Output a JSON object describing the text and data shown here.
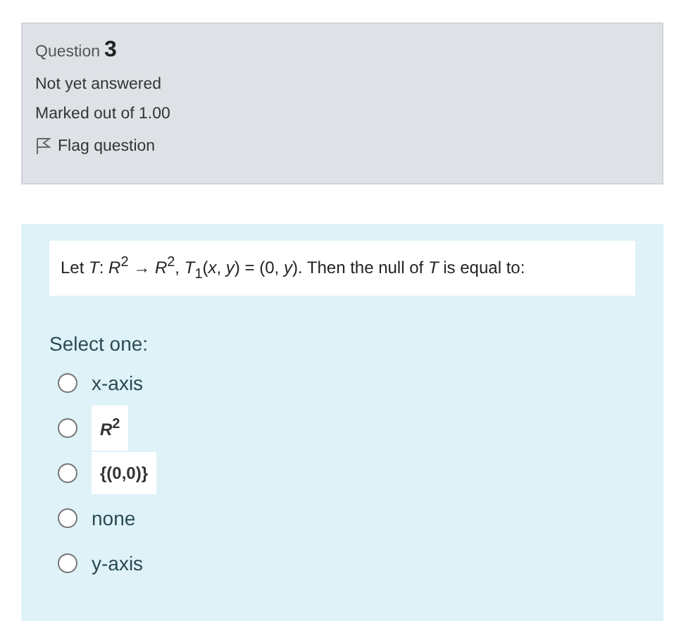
{
  "info": {
    "label": "Question",
    "number": "3",
    "state": "Not yet answered",
    "marks": "Marked out of 1.00",
    "flag": "Flag question"
  },
  "question": {
    "text": "Let *T*: *R*$^{2}$ → *R*$^{2}$, *T*$_{1}$(*x*, *y*) = (0, *y*). Then the null of *T* is equal to:",
    "prompt": "Select one:",
    "options": [
      {
        "kind": "plain",
        "label": "x-axis",
        "selected": false
      },
      {
        "kind": "boxed",
        "label": "*R*$^{2}$",
        "selected": false
      },
      {
        "kind": "boxed",
        "label": "{(0,0)}",
        "selected": false
      },
      {
        "kind": "plain",
        "label": "none",
        "selected": false
      },
      {
        "kind": "plain",
        "label": "y-axis",
        "selected": false
      }
    ]
  }
}
